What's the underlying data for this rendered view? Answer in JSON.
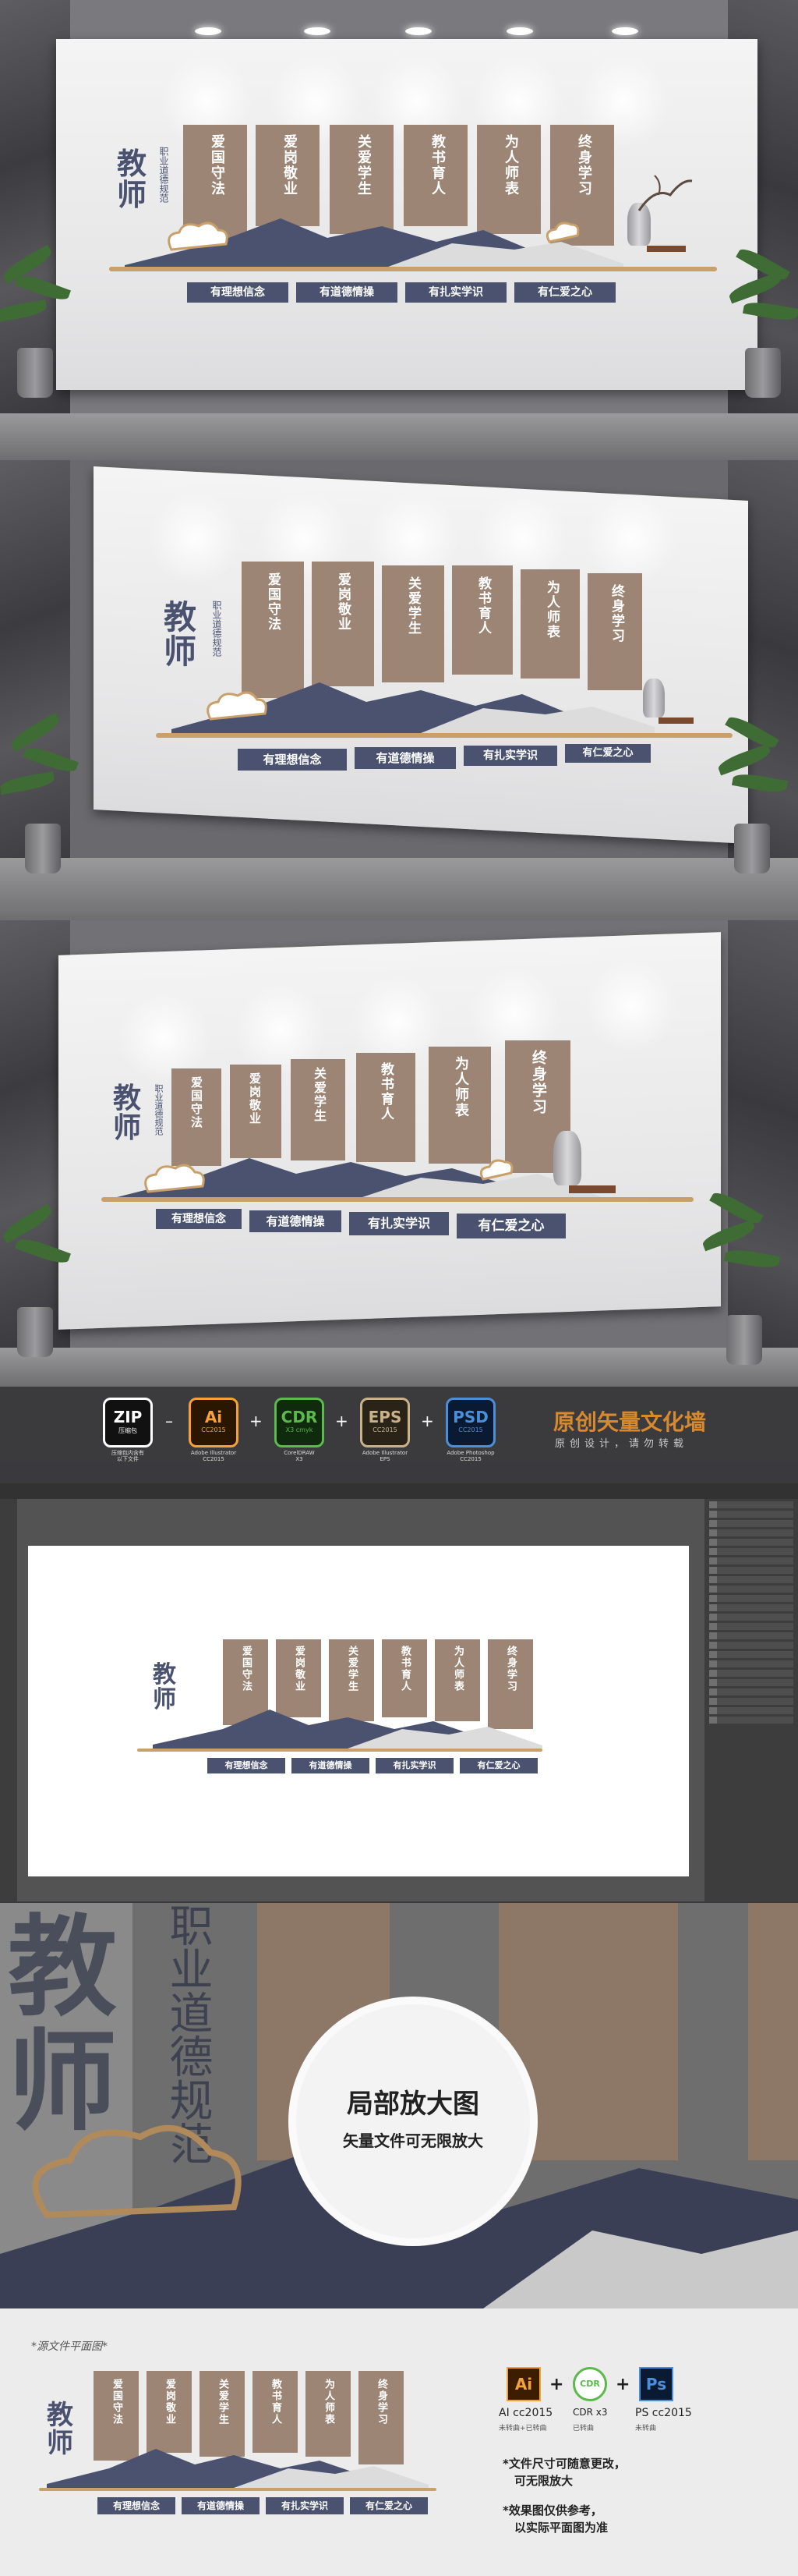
{
  "design": {
    "title_main": "教师",
    "title_sub": "职业道德规范",
    "banners": [
      "爱国守法",
      "爱岗敬业",
      "关爱学生",
      "教书育人",
      "为人师表",
      "终身学习"
    ],
    "tags": [
      "有理想信念",
      "有道德情操",
      "有扎实学识",
      "有仁爱之心"
    ]
  },
  "formats": [
    {
      "big": "ZIP",
      "small": "压缩包",
      "label": "压缩包内含有\n以下文件",
      "color": "#ffffff"
    },
    {
      "big": "Ai",
      "small": "CC2015",
      "label": "Adobe Illustrator\nCC2015",
      "color": "#f5a13a"
    },
    {
      "big": "CDR",
      "small": "X3 cmyk",
      "label": "CorelDRAW\nX3",
      "color": "#5cb94b"
    },
    {
      "big": "EPS",
      "small": "CC2015",
      "label": "Adobe Illustrator\nEPS",
      "color": "#c9b28a"
    },
    {
      "big": "PSD",
      "small": "CC2015",
      "label": "Adobe Photoshop\nCC2015",
      "color": "#4a8fd8"
    }
  ],
  "brand": {
    "title": "原创矢量文化墙",
    "subtitle": "原创设计，请勿转载"
  },
  "zoom": {
    "title": "局部放大图",
    "subtitle": "矢量文件可无限放大"
  },
  "flat": {
    "caption": "*源文件平面图*",
    "software": [
      {
        "icon": "Ai",
        "label": "AI cc2015",
        "note": "未转曲+已转曲",
        "color": "#f5a13a",
        "bg": "#3d1d00"
      },
      {
        "icon": "CDR",
        "label": "CDR x3",
        "note": "已转曲",
        "color": "#5cb94b",
        "bg": "#ffffff"
      },
      {
        "icon": "Ps",
        "label": "PS cc2015",
        "note": "未转曲",
        "color": "#4a8fd8",
        "bg": "#0b1a33"
      }
    ],
    "notes": [
      "*文件尺寸可随意更改，",
      "可无限放大",
      "*效果图仅供参考，",
      "以实际平面图为准"
    ]
  }
}
